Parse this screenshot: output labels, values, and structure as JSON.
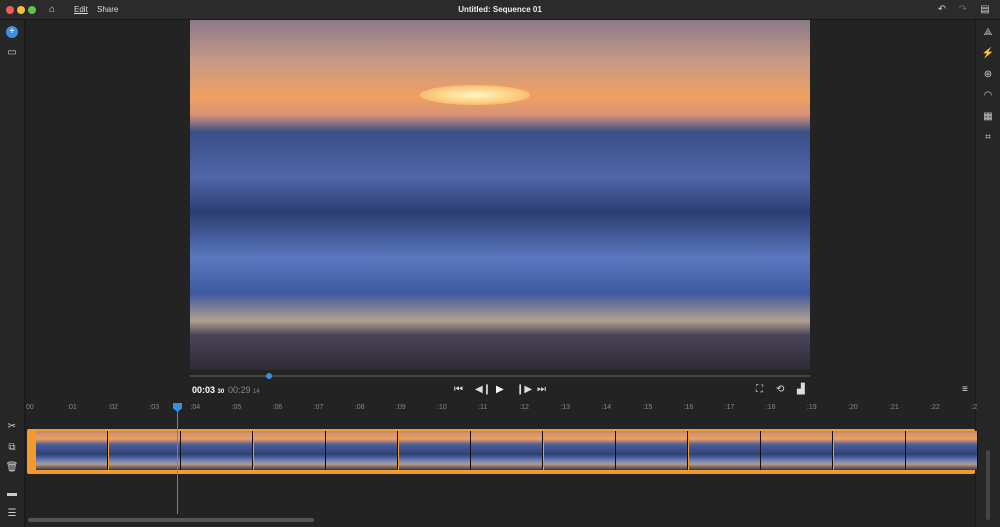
{
  "window": {
    "title": "Untitled: Sequence 01",
    "controls": [
      "close",
      "minimize",
      "maximize"
    ]
  },
  "nav": {
    "home_icon": "home-icon",
    "tabs": [
      {
        "label": "Edit",
        "active": true
      },
      {
        "label": "Share",
        "active": false
      }
    ]
  },
  "toolbar_right": {
    "undo_icon": "undo-icon",
    "redo_icon": "redo-icon",
    "feedback_icon": "chat-icon"
  },
  "left_tools": {
    "top": [
      "add-media-icon",
      "project-icon"
    ],
    "bottom": [
      "split-icon",
      "duplicate-icon",
      "delete-icon",
      "track-icon",
      "list-icon"
    ]
  },
  "right_tools": [
    "titles-icon",
    "transitions-icon",
    "color-icon",
    "speed-icon",
    "audio-icon",
    "crop-icon"
  ],
  "player": {
    "current_time": "00:03",
    "current_frame": "30",
    "duration": "00:29",
    "duration_frame": "14",
    "progress_percent": 10.5,
    "controls": [
      "go-to-start",
      "step-back",
      "play",
      "step-forward",
      "go-to-end"
    ],
    "view_controls": [
      "fit-icon",
      "loop-icon",
      "quality-icon"
    ],
    "menu_icon": "menu-icon"
  },
  "timeline": {
    "ruler_labels": [
      "00",
      ":01",
      ":02",
      ":03",
      ":04",
      ":05",
      ":06",
      ":07",
      ":08",
      ":09",
      ":10",
      ":11",
      ":12",
      ":13",
      ":14",
      ":15",
      ":16",
      ":17",
      ":18",
      ":19",
      ":20",
      ":21",
      ":22",
      ":2"
    ],
    "playhead_time": "00:03",
    "accent": "#f29a2e",
    "playhead_color": "#3a8ee6",
    "thumbnail_count": 13
  }
}
